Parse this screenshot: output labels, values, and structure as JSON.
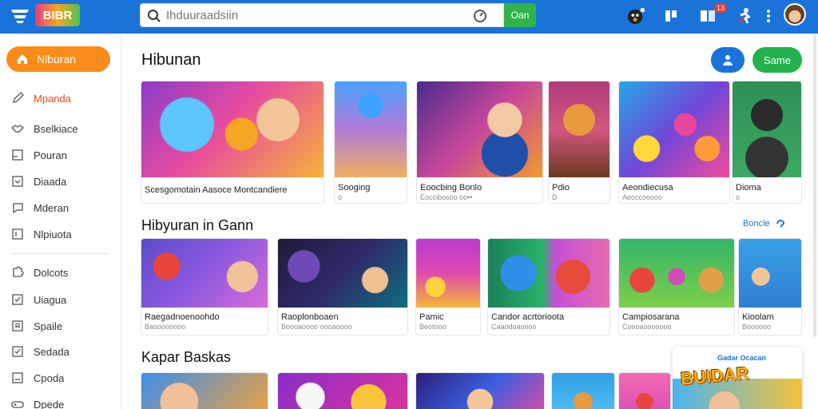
{
  "header": {
    "logo_text": "BIBR",
    "search_placeholder": "Ihduuraadsiin",
    "search_button": "Oan",
    "notification_count": "13",
    "colors": {
      "bar": "#1a73d9",
      "search_button": "#2fb34a"
    }
  },
  "sidebar": {
    "active_item": {
      "label": "Nlburan",
      "icon": "home-icon"
    },
    "items": [
      {
        "label": "Mpanda",
        "icon": "pen-icon",
        "highlight": true
      },
      {
        "label": "Bselkiace",
        "icon": "handshake-icon"
      },
      {
        "label": "Pouran",
        "icon": "square-icon"
      },
      {
        "label": "Diaada",
        "icon": "chevron-box-icon"
      },
      {
        "label": "Mderan",
        "icon": "chat-bubble-icon"
      },
      {
        "label": "Nlpiuota",
        "icon": "bracket-box-icon"
      },
      {
        "label": "Dolcots",
        "icon": "puzzle-icon"
      },
      {
        "label": "Uiagua",
        "icon": "check-box-icon"
      },
      {
        "label": "Spaile",
        "icon": "bookmark-box-icon"
      },
      {
        "label": "Sedada",
        "icon": "check-box-icon"
      },
      {
        "label": "Cpoda",
        "icon": "box-icon"
      },
      {
        "label": "Dpede",
        "icon": "gamepad-icon"
      }
    ]
  },
  "main": {
    "section1": {
      "title": "Hibunan",
      "game_button": "Same",
      "cards": [
        {
          "title": "Scesgomotain Aasoce Montcandiere",
          "subtitle": ""
        },
        {
          "title": "Sooging",
          "subtitle": "o"
        },
        {
          "title": "Eoocbing Bonlo",
          "subtitle": "Eoccibosoo oo••"
        },
        {
          "title": "Pdio",
          "subtitle": "D"
        },
        {
          "title": "Aeondiecusa",
          "subtitle": "Aeoccooooo"
        },
        {
          "title": "Dioma",
          "subtitle": "o"
        }
      ]
    },
    "section2": {
      "title": "Hibyuran in Gann",
      "see_all": "Boncle",
      "cards": [
        {
          "title": "Raegadnoenoohdo",
          "subtitle": "Baoooooooo"
        },
        {
          "title": "Raoplonboaen",
          "subtitle": "Boooaoooo oooaoooo"
        },
        {
          "title": "Pamic",
          "subtitle": "Beotooo"
        },
        {
          "title": "Candor acrtorioota",
          "subtitle": "Caaodoaorioo"
        },
        {
          "title": "Campiosarana",
          "subtitle": "Coooaooooooo"
        },
        {
          "title": "Kioolam",
          "subtitle": "Boooooo"
        }
      ]
    },
    "section3": {
      "title": "Kapar Baskas"
    },
    "promo": {
      "label": "Gadar Ocacan",
      "title": "BUIDAR"
    }
  }
}
